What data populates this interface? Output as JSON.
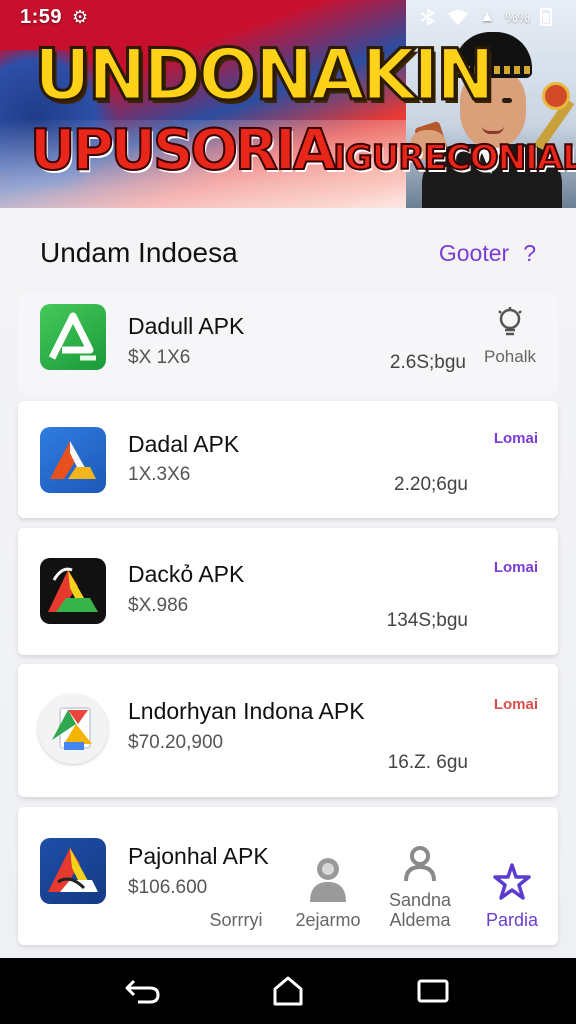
{
  "status_bar": {
    "time": "1:59",
    "notif": "⚙",
    "signal": "▲",
    "extra": "%%"
  },
  "banner": {
    "title_line1": "UNDONAKIN",
    "title_line2_big": "UPUSORIA",
    "title_line2_small": "IGURECONIALR!!",
    "colors": {
      "flag_red": "#c8102e",
      "flag_blue": "#2c4da0",
      "title_yellow": "#ffd21a",
      "title_red": "#e8261a"
    }
  },
  "section": {
    "title": "Undam Indoesa",
    "link": "Gooter",
    "link_icon": "?"
  },
  "apps": [
    {
      "name": "Dadull APK",
      "price": "$X 1X6",
      "size": "2.6S;bgu",
      "side_label": "Pohalk",
      "side_icon": "lightbulb-icon",
      "icon": "green-a-app-icon"
    },
    {
      "name": "Dadal APK",
      "price": "1X.3X6",
      "size": "2.20;6gu",
      "tag": "Lomai",
      "icon": "blue-a-app-icon"
    },
    {
      "name": "Dackỏ APK",
      "price": "$X.986",
      "size": "134S;bgu",
      "tag": "Lomai",
      "icon": "black-a-app-icon"
    },
    {
      "name": "Lndorhyan Indona APK",
      "price": "$70.20,900",
      "size": "16.Z. 6gu",
      "tag": "Lomai",
      "icon": "docs-app-icon"
    },
    {
      "name": "Pajonhal APK",
      "price": "$106.600",
      "icon": "navy-a-app-icon"
    }
  ],
  "tabs": [
    {
      "label": "Sorrryi"
    },
    {
      "label": "2ejarmo",
      "icon": "person-icon"
    },
    {
      "label": "Sandna Aldema",
      "icon": "person-outline-icon"
    },
    {
      "label": "Pardia",
      "icon": "star-icon",
      "active": true
    }
  ],
  "accent_color": "#7b3cd4",
  "nav": [
    "back-icon",
    "home-icon",
    "recents-icon"
  ]
}
